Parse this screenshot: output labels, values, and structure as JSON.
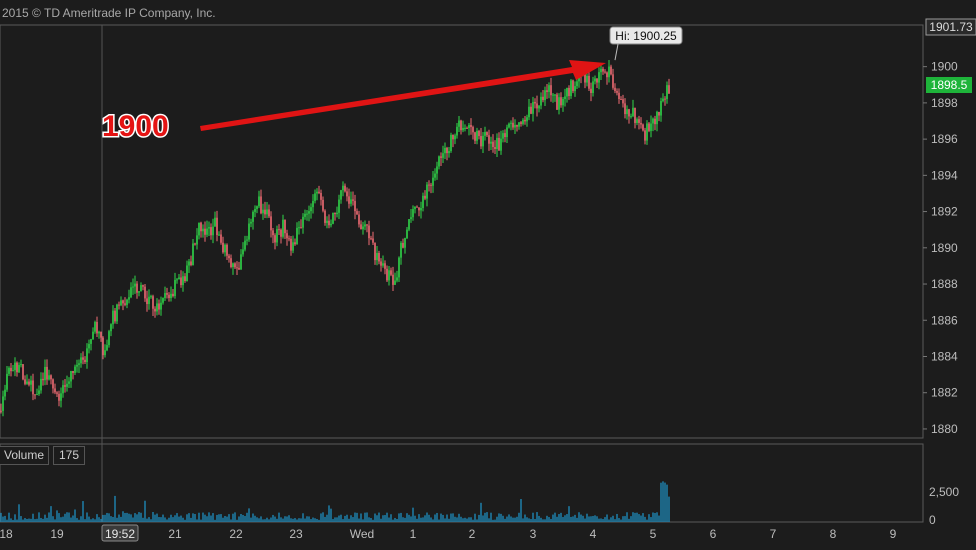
{
  "copyright": "2015 © TD Ameritrade IP Company, Inc.",
  "annotation": {
    "text": "1900"
  },
  "colors": {
    "up": "#2fd84a",
    "down": "#f06b73",
    "volume": "#1e86b4",
    "last_badge": "#1eb43a",
    "arrow": "#e01414"
  },
  "chart_data": [
    {
      "type": "candlestick",
      "x_tick_labels": [
        "18",
        "19",
        "19:52",
        "21",
        "22",
        "23",
        "Wed",
        "1",
        "2",
        "3",
        "4",
        "5",
        "6",
        "7",
        "8",
        "9"
      ],
      "y_ticks": [
        1880,
        1882,
        1884,
        1886,
        1888,
        1890,
        1892,
        1894,
        1896,
        1898,
        1900
      ],
      "ylim": [
        1879.5,
        1902.3
      ],
      "high": {
        "label": "Hi: 1900.25",
        "value": 1900.25
      },
      "last_price": "1898.5",
      "axis_top_value": "1901.73",
      "cursor_time": "19:52",
      "approx_close_path": [
        1881,
        1883.3,
        1883.5,
        1882.6,
        1882,
        1883.2,
        1882.2,
        1881.8,
        1883,
        1883.5,
        1884.2,
        1885.5,
        1884.3,
        1886.2,
        1886.7,
        1887.5,
        1887.9,
        1887.3,
        1886.6,
        1887.2,
        1887.7,
        1888,
        1889,
        1891.2,
        1890.8,
        1891.3,
        1890,
        1888.8,
        1889.3,
        1891.2,
        1892.5,
        1891.8,
        1890.5,
        1891.2,
        1890,
        1891.5,
        1892.2,
        1893,
        1891.3,
        1892,
        1893.5,
        1892.5,
        1891.3,
        1890.8,
        1889.2,
        1888.5,
        1888.2,
        1890.5,
        1892,
        1892.5,
        1893.3,
        1894.7,
        1895.5,
        1896.2,
        1897,
        1896.4,
        1895.8,
        1896.2,
        1895.7,
        1896.4,
        1897.2,
        1896.9,
        1897.6,
        1898.3,
        1898.7,
        1898,
        1898.5,
        1899.2,
        1899.6,
        1898.8,
        1900,
        1899.6,
        1898.7,
        1897.6,
        1897.2,
        1896.2,
        1896.8,
        1897.8,
        1898.8
      ],
      "volume": {
        "label": "Volume",
        "current": "175",
        "y_ticks": [
          "2,500",
          "0"
        ]
      }
    }
  ]
}
